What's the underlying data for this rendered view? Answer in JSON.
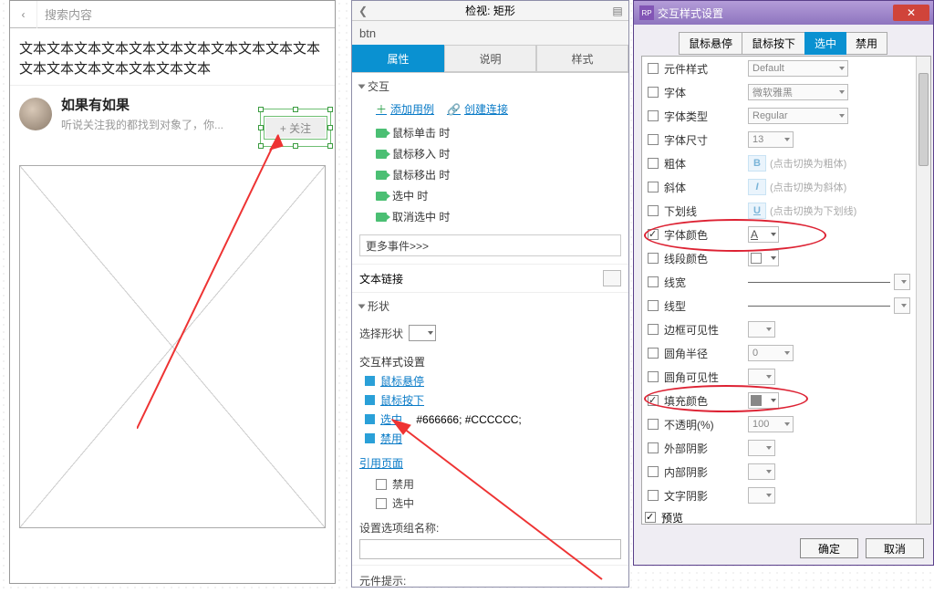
{
  "canvas": {
    "search_placeholder": "搜索内容",
    "body_text": "文本文本文本文本文本文本文本文本文本文本文本文本文本文本文本文本文本文本",
    "post_title": "如果有如果",
    "post_sub": "听说关注我的都找到对象了，你...",
    "btn_text": "+ 关注"
  },
  "inspect": {
    "panel_title": "检视: 矩形",
    "widget_name": "btn",
    "tabs": {
      "props": "属性",
      "notes": "说明",
      "style": "样式"
    },
    "sec_interact": "交互",
    "add_case": "添加用例",
    "create_link": "创建连接",
    "events": [
      "鼠标单击 时",
      "鼠标移入 时",
      "鼠标移出 时",
      "选中 时",
      "取消选中 时"
    ],
    "more_events": "更多事件>>>",
    "text_link": "文本链接",
    "sec_shape": "形状",
    "pick_shape": "选择形状",
    "istyle_hdr": "交互样式设置",
    "istyle_hover": "鼠标悬停",
    "istyle_down": "鼠标按下",
    "istyle_sel": "选中",
    "istyle_sel_val": "#666666; #CCCCCC;",
    "istyle_disabled": "禁用",
    "ref_pages": "引用页面",
    "chk_disabled": "禁用",
    "chk_selected": "选中",
    "sel_group": "设置选项组名称:",
    "footer_hint": "元件提示:"
  },
  "dialog": {
    "title": "交互样式设置",
    "tabs": [
      "鼠标悬停",
      "鼠标按下",
      "选中",
      "禁用"
    ],
    "active_tab": "选中",
    "rows": {
      "widget_style": {
        "label": "元件样式",
        "value": "Default"
      },
      "font": {
        "label": "字体",
        "value": "微软雅黑"
      },
      "font_type": {
        "label": "字体类型",
        "value": "Regular"
      },
      "font_size": {
        "label": "字体尺寸",
        "value": "13"
      },
      "bold": {
        "label": "粗体",
        "hint": "(点击切换为粗体)"
      },
      "italic": {
        "label": "斜体",
        "hint": "(点击切换为斜体)"
      },
      "underline": {
        "label": "下划线",
        "hint": "(点击切换为下划线)"
      },
      "font_color": {
        "label": "字体颜色"
      },
      "line_color": {
        "label": "线段颜色"
      },
      "line_width": {
        "label": "线宽"
      },
      "line_style": {
        "label": "线型"
      },
      "border_vis": {
        "label": "边框可见性"
      },
      "corner": {
        "label": "圆角半径",
        "value": "0"
      },
      "corner_vis": {
        "label": "圆角可见性"
      },
      "fill": {
        "label": "填充颜色"
      },
      "opacity": {
        "label": "不透明(%)",
        "value": "100"
      },
      "outer_shadow": {
        "label": "外部阴影"
      },
      "inner_shadow": {
        "label": "内部阴影"
      },
      "text_shadow": {
        "label": "文字阴影"
      }
    },
    "preview": "预览",
    "ok": "确定",
    "cancel": "取消"
  }
}
